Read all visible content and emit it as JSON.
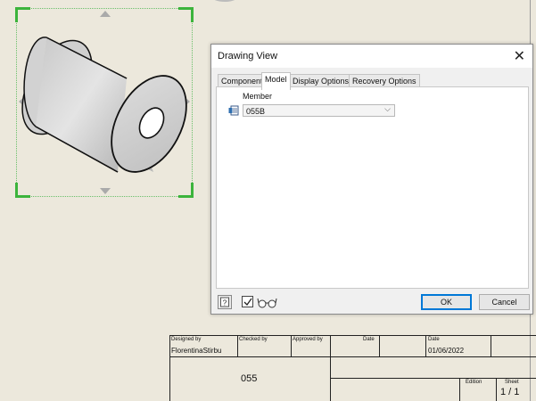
{
  "dialog": {
    "title": "Drawing View",
    "tabs": [
      "Component",
      "Model",
      "Display Options",
      "Recovery Options"
    ],
    "member_label": "Member",
    "member_value": "055B",
    "ok_label": "OK",
    "cancel_label": "Cancel"
  },
  "title_block": {
    "designed_by_label": "Designed by",
    "designed_by_value": "FlorentinaStirbu",
    "checked_by_label": "Checked by",
    "approved_by_label": "Approved by",
    "date_label_1": "Date",
    "date_label_2": "Date",
    "date_value": "01/06/2022",
    "part_number": "055",
    "edition_label": "Edition",
    "sheet_label": "Sheet",
    "sheet_value": "1 / 1"
  },
  "colors": {
    "sheet_background": "#ece8dc",
    "selection_green": "#3cb43c",
    "ok_border": "#0078d7"
  }
}
